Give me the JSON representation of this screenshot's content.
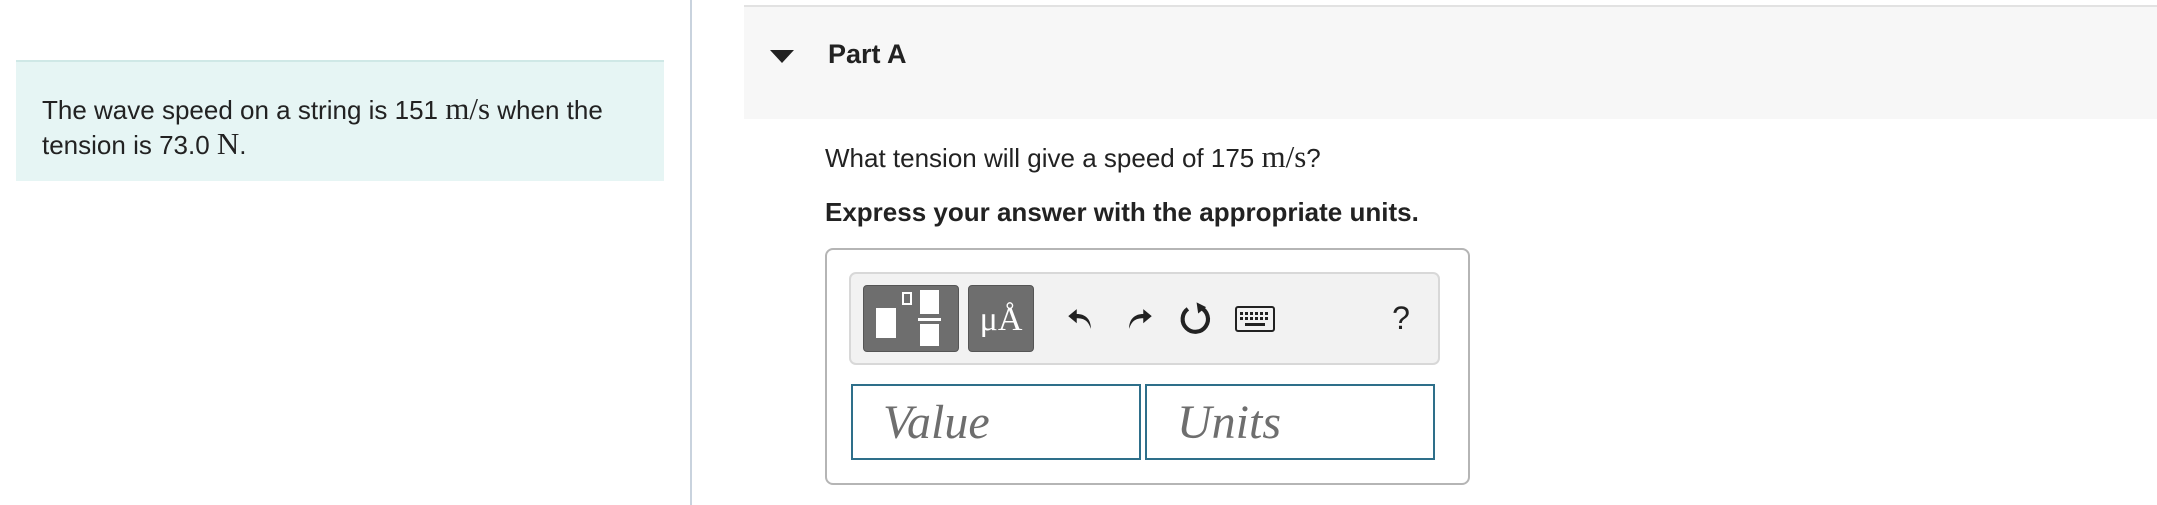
{
  "problem": {
    "text_before": "The wave speed on a string is 151 ",
    "speed_unit": "m/s",
    "text_middle": " when the tension is 73.0 ",
    "tension_unit": "N",
    "text_after": "."
  },
  "part": {
    "title": "Part A"
  },
  "question": {
    "text_before": "What tension will give a speed of 175 ",
    "unit": "m/s",
    "text_after": "?"
  },
  "instruction": "Express your answer with the appropriate units.",
  "toolbar": {
    "units_button_label": "μÅ",
    "help_label": "?",
    "icons": [
      "templates-icon",
      "units-icon",
      "undo-icon",
      "redo-icon",
      "reset-icon",
      "keyboard-icon",
      "help-icon"
    ]
  },
  "inputs": {
    "value_placeholder": "Value",
    "units_placeholder": "Units"
  },
  "colors": {
    "problem_bg": "#e6f5f4",
    "input_border": "#2e6f8a",
    "toolbar_button": "#6e6e6e"
  }
}
